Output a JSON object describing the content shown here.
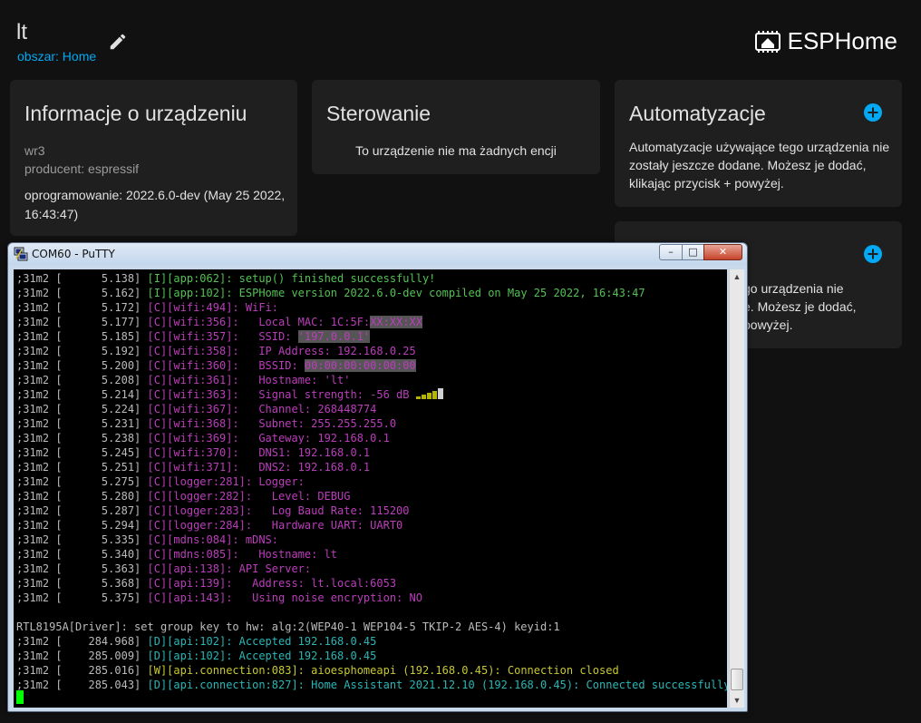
{
  "header": {
    "device_name": "lt",
    "area_link": "obszar: Home",
    "brand_name": "ESPHome"
  },
  "cards": {
    "info": {
      "title": "Informacje o urządzeniu",
      "model": "wr3",
      "manufacturer": "producent: espressif",
      "firmware": "oprogramowanie: 2022.6.0-dev (May 25 2022, 16:43:47)"
    },
    "control": {
      "title": "Sterowanie",
      "empty_text": "To urządzenie nie ma żadnych encji"
    },
    "automation": {
      "title": "Automatyzacje",
      "text": "Automatyzacje używające tego urządzenia nie zostały jeszcze dodane. Możesz je dodać, klikając przycisk + powyżej."
    },
    "fourth": {
      "text_partial": "go urządzenia nie\ne. Możesz je dodać,\npowyżej."
    }
  },
  "putty": {
    "title": "COM60 - PuTTY",
    "min_label": "–",
    "max_label": "□",
    "close_label": "✕",
    "lines": [
      {
        "prefix": ";31m2 [      5.138] ",
        "tag": "[I][app:062]: ",
        "msg": "setup() finished successfully!",
        "color": "green"
      },
      {
        "prefix": ";31m2 [      5.162] ",
        "tag": "[I][app:102]: ",
        "msg": "ESPHome version 2022.6.0-dev compiled on May 25 2022, 16:43:47",
        "color": "green"
      },
      {
        "prefix": ";31m2 [      5.172] ",
        "tag": "[C][wifi:494]: ",
        "msg": "WiFi:",
        "color": "magenta"
      },
      {
        "prefix": ";31m2 [      5.177] ",
        "tag": "[C][wifi:356]: ",
        "msg": "  Local MAC: 1C:5F:",
        "redact": "XX:XX:XX",
        "color": "magenta"
      },
      {
        "prefix": ";31m2 [      5.185] ",
        "tag": "[C][wifi:357]: ",
        "msg": "  SSID: ",
        "redact": "'197.0.0.1'",
        "color": "magenta"
      },
      {
        "prefix": ";31m2 [      5.192] ",
        "tag": "[C][wifi:358]: ",
        "msg": "  IP Address: 192.168.0.25",
        "color": "magenta"
      },
      {
        "prefix": ";31m2 [      5.200] ",
        "tag": "[C][wifi:360]: ",
        "msg": "  BSSID: ",
        "redact": "00:00:00:00:00:00",
        "color": "magenta"
      },
      {
        "prefix": ";31m2 [      5.208] ",
        "tag": "[C][wifi:361]: ",
        "msg": "  Hostname: 'lt'",
        "color": "magenta"
      },
      {
        "prefix": ";31m2 [      5.214] ",
        "tag": "[C][wifi:363]: ",
        "msg": "  Signal strength: -56 dB ",
        "signal": true,
        "color": "magenta"
      },
      {
        "prefix": ";31m2 [      5.224] ",
        "tag": "[C][wifi:367]: ",
        "msg": "  Channel: 268448774",
        "color": "magenta"
      },
      {
        "prefix": ";31m2 [      5.231] ",
        "tag": "[C][wifi:368]: ",
        "msg": "  Subnet: 255.255.255.0",
        "color": "magenta"
      },
      {
        "prefix": ";31m2 [      5.238] ",
        "tag": "[C][wifi:369]: ",
        "msg": "  Gateway: 192.168.0.1",
        "color": "magenta"
      },
      {
        "prefix": ";31m2 [      5.245] ",
        "tag": "[C][wifi:370]: ",
        "msg": "  DNS1: 192.168.0.1",
        "color": "magenta"
      },
      {
        "prefix": ";31m2 [      5.251] ",
        "tag": "[C][wifi:371]: ",
        "msg": "  DNS2: 192.168.0.1",
        "color": "magenta"
      },
      {
        "prefix": ";31m2 [      5.275] ",
        "tag": "[C][logger:281]: ",
        "msg": "Logger:",
        "color": "magenta"
      },
      {
        "prefix": ";31m2 [      5.280] ",
        "tag": "[C][logger:282]: ",
        "msg": "  Level: DEBUG",
        "color": "magenta"
      },
      {
        "prefix": ";31m2 [      5.287] ",
        "tag": "[C][logger:283]: ",
        "msg": "  Log Baud Rate: 115200",
        "color": "magenta"
      },
      {
        "prefix": ";31m2 [      5.294] ",
        "tag": "[C][logger:284]: ",
        "msg": "  Hardware UART: UART0",
        "color": "magenta"
      },
      {
        "prefix": ";31m2 [      5.335] ",
        "tag": "[C][mdns:084]: ",
        "msg": "mDNS:",
        "color": "magenta"
      },
      {
        "prefix": ";31m2 [      5.340] ",
        "tag": "[C][mdns:085]: ",
        "msg": "  Hostname: lt",
        "color": "magenta"
      },
      {
        "prefix": ";31m2 [      5.363] ",
        "tag": "[C][api:138]: ",
        "msg": "API Server:",
        "color": "magenta"
      },
      {
        "prefix": ";31m2 [      5.368] ",
        "tag": "[C][api:139]: ",
        "msg": "  Address: lt.local:6053",
        "color": "magenta"
      },
      {
        "prefix": ";31m2 [      5.375] ",
        "tag": "[C][api:143]: ",
        "msg": "  Using noise encryption: NO",
        "color": "magenta"
      },
      {
        "prefix": "",
        "tag": "",
        "msg": "",
        "color": "grey"
      },
      {
        "prefix": "RTL8195A[Driver]: set group key to hw: alg:2(WEP40-1 WEP104-5 TKIP-2 AES-4) keyid:1",
        "tag": "",
        "msg": "",
        "color": "grey"
      },
      {
        "prefix": ";31m2 [    284.968] ",
        "tag": "[D][api:102]: ",
        "msg": "Accepted 192.168.0.45",
        "color": "cyan"
      },
      {
        "prefix": ";31m2 [    285.009] ",
        "tag": "[D][api:102]: ",
        "msg": "Accepted 192.168.0.45",
        "color": "cyan"
      },
      {
        "prefix": ";31m2 [    285.016] ",
        "tag": "[W][api.connection:083]: ",
        "msg": "aioesphomeapi (192.168.0.45): Connection closed",
        "color": "yellow"
      },
      {
        "prefix": ";31m2 [    285.043] ",
        "tag": "[D][api.connection:827]: ",
        "msg": "Home Assistant 2021.12.10 (192.168.0.45): Connected successfully",
        "color": "cyan"
      }
    ]
  }
}
